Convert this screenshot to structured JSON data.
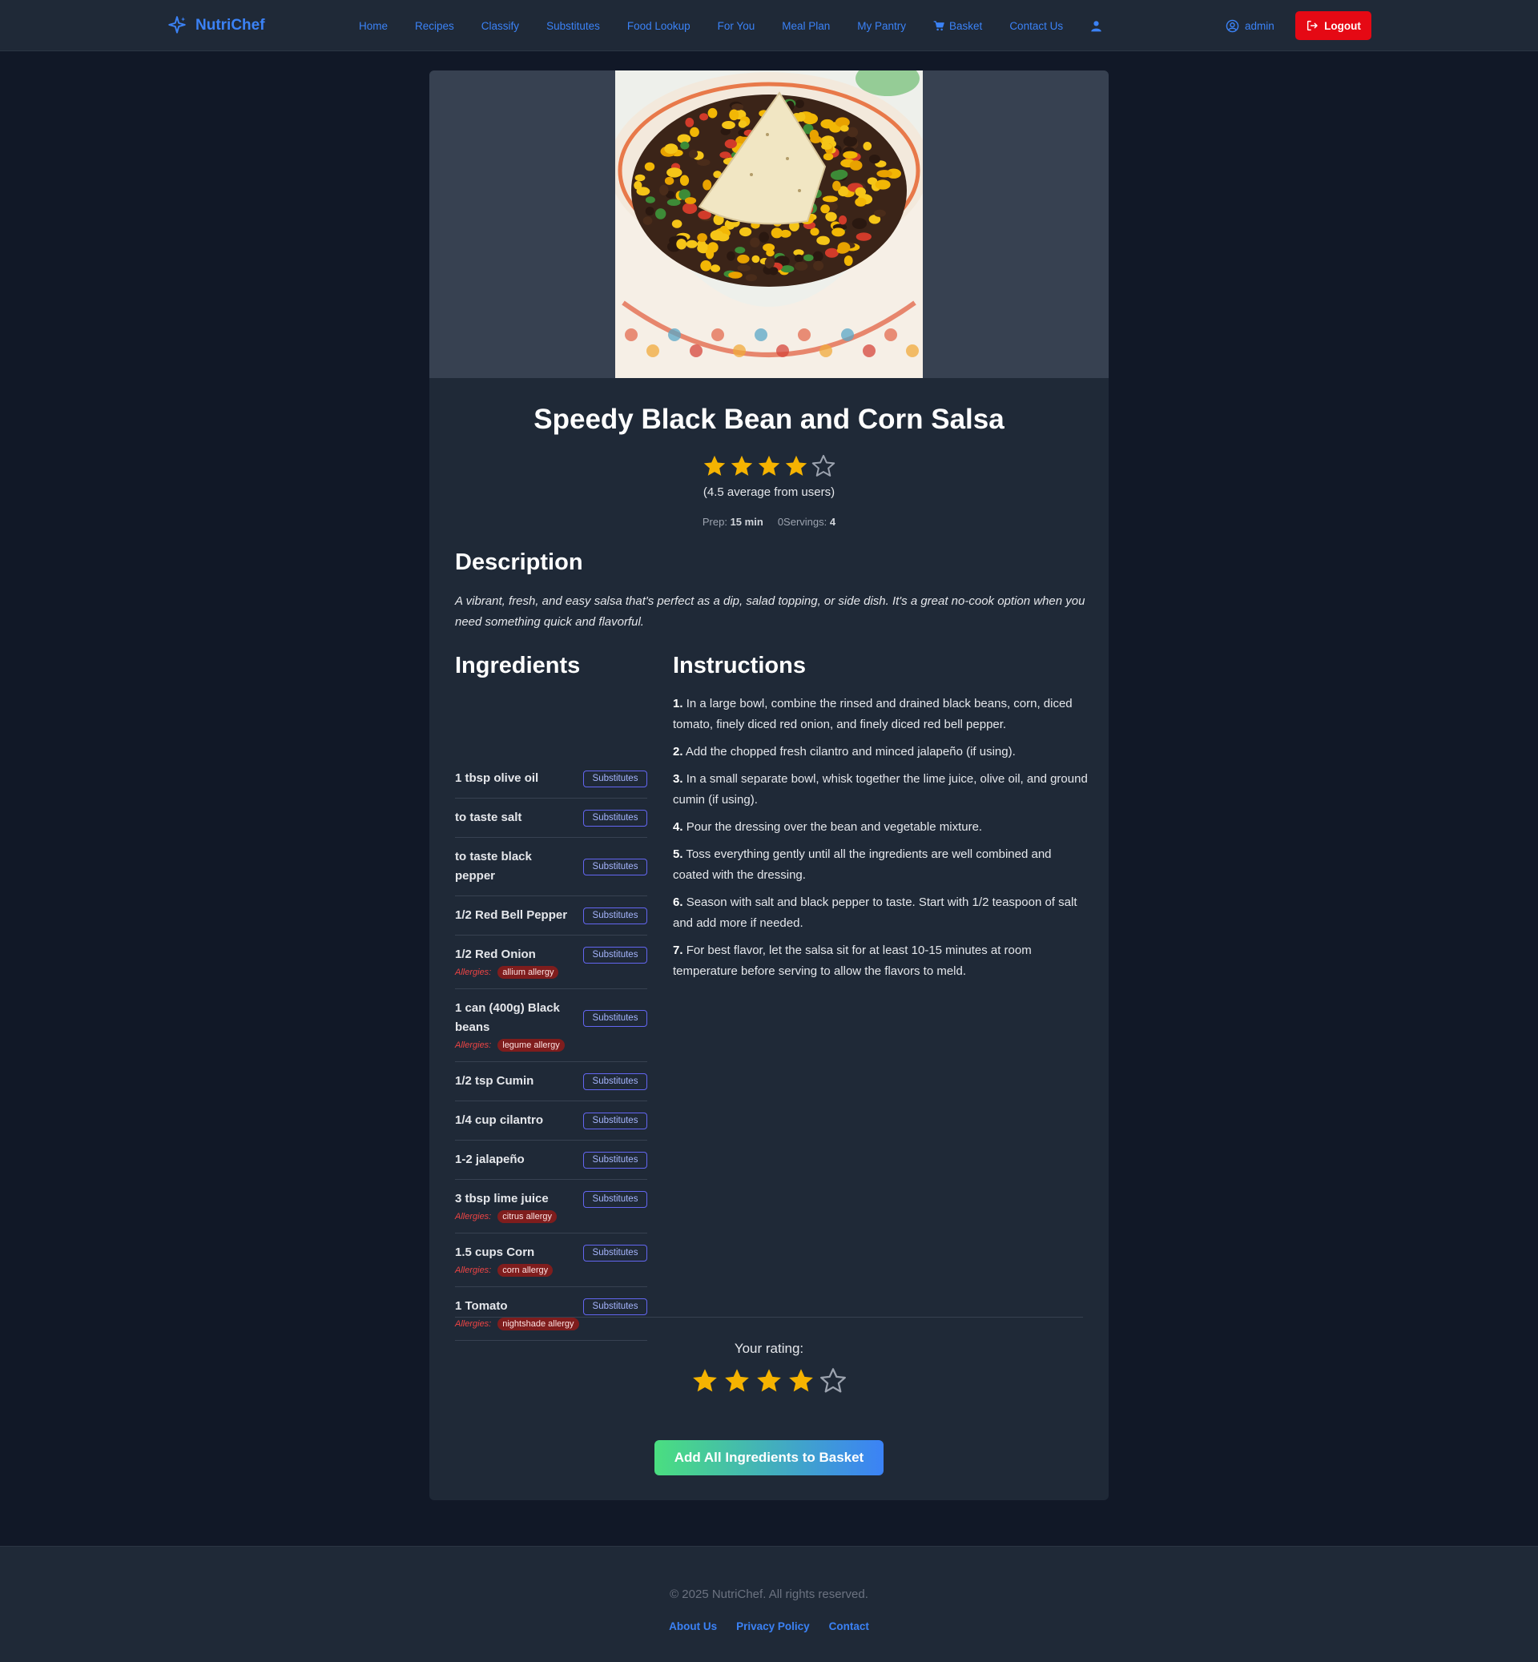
{
  "brand": {
    "name": "NutriChef",
    "color": "#3b82f6"
  },
  "nav": {
    "links": [
      {
        "label": "Home"
      },
      {
        "label": "Recipes"
      },
      {
        "label": "Classify"
      },
      {
        "label": "Substitutes"
      },
      {
        "label": "Food Lookup"
      },
      {
        "label": "For You"
      },
      {
        "label": "Meal Plan"
      },
      {
        "label": "My Pantry"
      },
      {
        "label": "Basket",
        "icon": "cart-icon"
      },
      {
        "label": "Contact Us"
      }
    ],
    "user_icon": "user-icon",
    "username": "admin",
    "logout_label": "Logout"
  },
  "recipe": {
    "image_alt": "black bean and corn salsa in a bowl with a tortilla chip",
    "title": "Speedy Black Bean and Corn Salsa",
    "average_rating": 4.5,
    "average_text": "(4.5 average from users)",
    "prep_label": "Prep:",
    "prep_value": "15 min",
    "servings_label": "0Servings:",
    "servings_value": "4",
    "description_heading": "Description",
    "description": "A vibrant, fresh, and easy salsa that's perfect as a dip, salad topping, or side dish. It's a great no-cook option when you need something quick and flavorful.",
    "ingredients_heading": "Ingredients",
    "substitutes_label": "Substitutes",
    "allergies_label": "Allergies:",
    "ingredients": [
      {
        "name": "1 tbsp olive oil"
      },
      {
        "name": "to taste salt"
      },
      {
        "name": "to taste black pepper"
      },
      {
        "name": "1/2 Red Bell Pepper"
      },
      {
        "name": "1/2 Red Onion",
        "allergy": "allium allergy"
      },
      {
        "name": "1 can (400g) Black beans",
        "allergy": "legume allergy"
      },
      {
        "name": "1/2 tsp Cumin"
      },
      {
        "name": "1/4 cup cilantro"
      },
      {
        "name": "1-2 jalapeño"
      },
      {
        "name": "3 tbsp lime juice",
        "allergy": "citrus allergy"
      },
      {
        "name": "1.5 cups Corn",
        "allergy": "corn allergy"
      },
      {
        "name": "1 Tomato",
        "allergy": "nightshade allergy"
      }
    ],
    "instructions_heading": "Instructions",
    "instructions": [
      {
        "num": "1.",
        "text": "In a large bowl, combine the rinsed and drained black beans, corn, diced tomato, finely diced red onion, and finely diced red bell pepper."
      },
      {
        "num": "2.",
        "text": "Add the chopped fresh cilantro and minced jalapeño (if using)."
      },
      {
        "num": "3.",
        "text": "In a small separate bowl, whisk together the lime juice, olive oil, and ground cumin (if using)."
      },
      {
        "num": "4.",
        "text": "Pour the dressing over the bean and vegetable mixture."
      },
      {
        "num": "5.",
        "text": "Toss everything gently until all the ingredients are well combined and coated with the dressing."
      },
      {
        "num": "6.",
        "text": "Season with salt and black pepper to taste. Start with 1/2 teaspoon of salt and add more if needed."
      },
      {
        "num": "7.",
        "text": "For best flavor, let the salsa sit for at least 10-15 minutes at room temperature before serving to allow the flavors to meld."
      }
    ],
    "your_rating_label": "Your rating:",
    "user_rating": 4,
    "add_all_label": "Add All Ingredients to Basket"
  },
  "colors": {
    "page_bg": "#111827",
    "card_bg": "#1f2937",
    "star_filled": "#f5b301",
    "logout_bg": "#e50914",
    "allergy_badge_bg": "#7f1d1d"
  },
  "footer": {
    "copyright": "© 2025 NutriChef. All rights reserved.",
    "links": [
      {
        "label": "About Us"
      },
      {
        "label": "Privacy Policy"
      },
      {
        "label": "Contact"
      }
    ]
  }
}
